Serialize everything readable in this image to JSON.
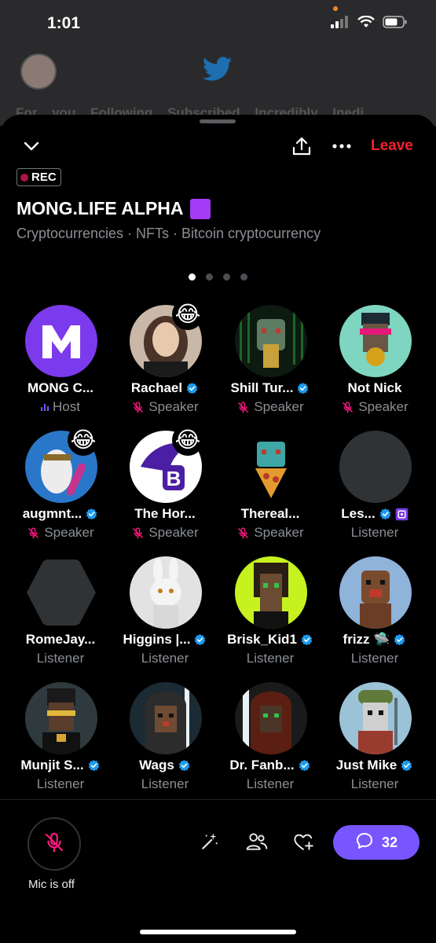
{
  "status_bar": {
    "time": "1:01"
  },
  "space": {
    "rec_label": "REC",
    "title": "MONG.LIFE ALPHA",
    "topics": "Cryptocurrencies · NFTs · Bitcoin cryptocurrency",
    "leave_label": "Leave",
    "page_indicator": {
      "pages": 4,
      "current": 1
    }
  },
  "participants": [
    {
      "name": "MONG C...",
      "role": "Host",
      "verified": false,
      "muted": false,
      "emoji": "",
      "avatar_color": "#7c3aed"
    },
    {
      "name": "Rachael",
      "role": "Speaker",
      "verified": true,
      "muted": true,
      "emoji": "😂",
      "avatar_color": "#c9b7a7"
    },
    {
      "name": "Shill Tur...",
      "role": "Speaker",
      "verified": true,
      "muted": true,
      "emoji": "",
      "avatar_color": "#0d1a10"
    },
    {
      "name": "Not Nick",
      "role": "Speaker",
      "verified": false,
      "muted": true,
      "emoji": "",
      "avatar_color": "#7fd6c0"
    },
    {
      "name": "augmnt...",
      "role": "Speaker",
      "verified": true,
      "muted": true,
      "emoji": "😂",
      "avatar_color": "#2a77c9"
    },
    {
      "name": "The Hor...",
      "role": "Speaker",
      "verified": false,
      "muted": true,
      "emoji": "😂",
      "avatar_color": "#ffffff"
    },
    {
      "name": "Thereal...",
      "role": "Speaker",
      "verified": false,
      "muted": true,
      "emoji": "",
      "avatar_color": "#000000"
    },
    {
      "name": "Les...",
      "role": "Listener",
      "verified": true,
      "muted": false,
      "emoji": "",
      "avatar_color": "#303336"
    },
    {
      "name": "RomeJay...",
      "role": "Listener",
      "verified": false,
      "muted": false,
      "emoji": "",
      "avatar_color": "#303336"
    },
    {
      "name": "Higgins |...",
      "role": "Listener",
      "verified": true,
      "muted": false,
      "emoji": "",
      "avatar_color": "#e2e2e2"
    },
    {
      "name": "Brisk_Kid1",
      "role": "Listener",
      "verified": true,
      "muted": false,
      "emoji": "",
      "avatar_color": "#c6f21f"
    },
    {
      "name": "frizz 🛸",
      "role": "Listener",
      "verified": true,
      "muted": false,
      "emoji": "",
      "avatar_color": "#8fb3d9"
    },
    {
      "name": "Munjit S...",
      "role": "Listener",
      "verified": true,
      "muted": false,
      "emoji": "",
      "avatar_color": "#2e3a3e"
    },
    {
      "name": "Wags",
      "role": "Listener",
      "verified": true,
      "muted": false,
      "emoji": "",
      "avatar_color": "#1c2a33"
    },
    {
      "name": "Dr. Fanb...",
      "role": "Listener",
      "verified": true,
      "muted": false,
      "emoji": "",
      "avatar_color": "#1a1a1a"
    },
    {
      "name": "Just Mike",
      "role": "Listener",
      "verified": true,
      "muted": false,
      "emoji": "",
      "avatar_color": "#9bc2d6"
    }
  ],
  "bottom_bar": {
    "mic_label": "Mic is off",
    "chat_count": "32"
  },
  "background": {
    "tabs": "For you   Following   Subscribed   Incredibly Inedi..."
  },
  "colors": {
    "accent": "#7856ff",
    "leave": "#f4212e",
    "verified": "#1d9bf0",
    "muted_red": "#f91880",
    "secondary_text": "#8b8f94"
  }
}
